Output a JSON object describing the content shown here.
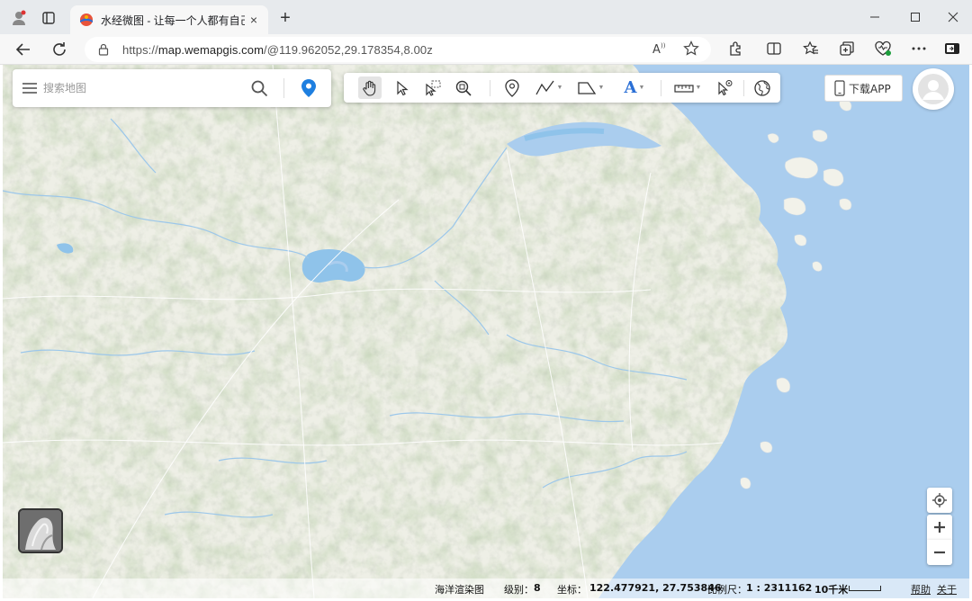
{
  "browser": {
    "tab_title": "水经微图 - 让每一个人都有自己的",
    "tab_close": "×",
    "new_tab": "+",
    "url_prefix": "https://",
    "url_host": "map.wemapgis.com",
    "url_path": "/@119.962052,29.178354,8.00z",
    "icons": [
      "profile-icon",
      "tabs-icon",
      "back-icon",
      "reload-icon",
      "lock-icon",
      "read-aloud-icon",
      "favorite-icon",
      "extensions-icon",
      "split-screen-icon",
      "favorites-icon",
      "collections-icon",
      "performance-icon",
      "more-icon",
      "sidebar-icon"
    ]
  },
  "search": {
    "placeholder": "搜索地图"
  },
  "toolbar": {
    "tools": [
      "pan-tool",
      "select-tool",
      "box-select-tool",
      "zoom-extent-tool",
      "marker-tool",
      "polyline-tool",
      "polygon-tool",
      "text-tool",
      "measure-tool",
      "identify-tool",
      "globe-tool"
    ],
    "text_tool_glyph": "A"
  },
  "download_app": "下载APP",
  "status": {
    "layer_name": "海洋渲染图",
    "level_label": "级别：",
    "level_value": "8",
    "coord_label": "坐标：",
    "coord_value": "122.477921, 27.753846",
    "scale_label": "比例尺：",
    "scale_value": "1 : 2311162",
    "scale_bar_label": "10千米",
    "help_link": "帮助",
    "about_link": "关于"
  },
  "colors": {
    "land": "#eeefe6",
    "forest": "#cfdcbc",
    "sea": "#aacdee",
    "water": "#8fc3ea",
    "accent_blue": "#1e7fe0"
  }
}
